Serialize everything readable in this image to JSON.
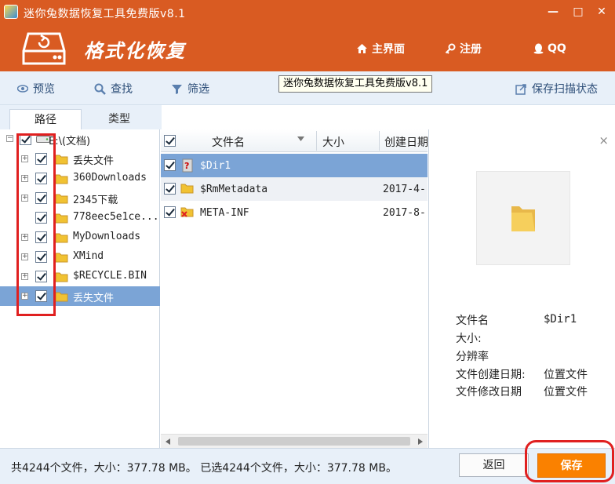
{
  "window": {
    "title": "迷你兔数据恢复工具免费版v8.1",
    "minimize_glyph": "—",
    "maximize_glyph": "□",
    "close_glyph": "✕"
  },
  "header": {
    "app_name": "格式化恢复",
    "nav": [
      {
        "label": "主界面",
        "icon": "home-icon"
      },
      {
        "label": "注册",
        "icon": "key-icon"
      },
      {
        "label": "QQ",
        "icon": "qq-penguin-icon"
      }
    ]
  },
  "toolbar": {
    "preview_label": "预览",
    "search_label": "查找",
    "filter_label": "筛选",
    "save_scan_label": "保存扫描状态",
    "tooltip": "迷你兔数据恢复工具免费版v8.1"
  },
  "tabs": {
    "path_label": "路径",
    "type_label": "类型"
  },
  "tree": {
    "root_label": "E:\\(文档)",
    "items": [
      {
        "label": "丢失文件"
      },
      {
        "label": "360Downloads"
      },
      {
        "label": "2345下载"
      },
      {
        "label": "778eec5e1ce..."
      },
      {
        "label": "MyDownloads"
      },
      {
        "label": "XMind"
      },
      {
        "label": "$RECYCLE.BIN"
      },
      {
        "label": "丢失文件"
      }
    ]
  },
  "filelist": {
    "columns": {
      "name": "文件名",
      "size": "大小",
      "created": "创建日期"
    },
    "rows": [
      {
        "name": "$Dir1",
        "size": "",
        "created": ""
      },
      {
        "name": "$RmMetadata",
        "size": "",
        "created": "2017-4-"
      },
      {
        "name": "META-INF",
        "size": "",
        "created": "2017-8-"
      }
    ]
  },
  "preview": {
    "close_glyph": "×",
    "fields": [
      {
        "key": "文件名",
        "value": "$Dir1"
      },
      {
        "key": "大小:",
        "value": ""
      },
      {
        "key": "分辨率",
        "value": ""
      },
      {
        "key": "文件创建日期:",
        "value": "位置文件"
      },
      {
        "key": "文件修改日期",
        "value": "位置文件"
      }
    ]
  },
  "status": {
    "summary": "共4244个文件，大小：377.78 MB。 已选4244个文件，大小：377.78 MB。",
    "back_label": "返回",
    "save_label": "保存"
  },
  "colors": {
    "brand_orange": "#d95b22",
    "save_orange": "#fa8100",
    "selection_blue": "#7ba4d6",
    "annotation_red": "#e02020"
  }
}
